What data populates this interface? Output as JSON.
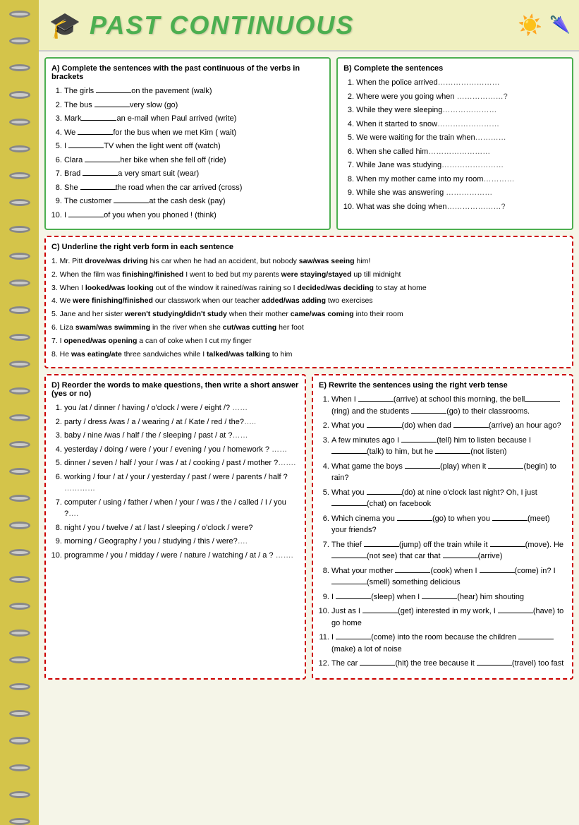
{
  "header": {
    "title": "PAST CONTINUOUS"
  },
  "sectionA": {
    "title": "A) Complete the sentences with the past continuous of the verbs in brackets",
    "items": [
      "The girls ______on the pavement  (walk)",
      "The bus __________very slow (go)",
      "Mark______an e-mail when Paul arrived (write)",
      "We ______for the bus when we met Kim ( wait)",
      "I ________TV when the light went off (watch)",
      "Clara ______her bike when she fell off (ride)",
      "Brad __________a very smart suit (wear)",
      "She ____the road when the car arrived (cross)",
      "The customer ______at the cash desk (pay)",
      "I ________of you when you phoned ! (think)"
    ]
  },
  "sectionB": {
    "title": "B) Complete the sentences",
    "items": [
      "When the police arrived……………………",
      "Where were you going when ………………?",
      "While they were sleeping…………………",
      "When it started to snow……………………",
      "We were waiting for the train when…………",
      "When she called him……………………",
      "While Jane was studying……………………",
      "When my mother came into my room…………",
      "While she was answering ………………",
      "What was she doing when…………………?"
    ]
  },
  "sectionC": {
    "title": "C) Underline the right verb form in each sentence",
    "items": [
      "Mr. Pitt drove/was driving his car when he had an accident, but nobody saw/was seeing him!",
      "When the film was finishing/finished I went to bed but my parents were staying/stayed up till midnight",
      "When I looked/was looking out of the window it rained/was raining so I decided/was deciding to stay at home",
      "We were finishing/finished our classwork when our teacher added/was adding two exercises",
      "Jane and her sister weren't studying/didn't study when their mother came/was coming into their room",
      "Liza swam/was swimming in the river when she cut/was cutting her foot",
      "I opened/was opening a can of coke when I cut my finger",
      "He was eating/ate three sandwiches while I talked/was talking to him"
    ],
    "bold_pairs": [
      [
        "drove/was driving",
        "saw/was seeing"
      ],
      [
        "was finishing/finished",
        "were staying/stayed"
      ],
      [
        "looked/was looking",
        "decided/was deciding"
      ],
      [
        "were finishing/finished",
        "added/was adding"
      ],
      [
        "weren't studying/didn't study",
        "came/was coming"
      ],
      [
        "swam/was swimming",
        "cut/was cutting"
      ],
      [
        "opened/was opening"
      ],
      [
        "was eating/ate",
        "talked/was talking"
      ]
    ]
  },
  "sectionD": {
    "title": "D) Reorder the words to make questions, then write a short answer (yes or no)",
    "items": [
      "you /at / dinner / having / o'clock / were / eight /? ……",
      "party / dress /was / a / wearing / at / Kate / red / the?…..",
      "baby / nine /was / half / the / sleeping / past / at ?……",
      "yesterday / doing / were / your / evening / you / homework ? ……",
      "dinner / seven / half / your / was / at / cooking / past / mother ?…….",
      "working / four / at / your / yesterday / past / were / parents / half ? …………",
      "computer / using / father / when / your / was / the / called / I / you ?….",
      "night / you / twelve / at / last / sleeping / o'clock / were?",
      "morning / Geography / you / studying / this / were?….",
      "programme / you / midday / were / nature / watching / at / a ? ……."
    ]
  },
  "sectionE": {
    "title": "E) Rewrite the sentences using the right verb tense",
    "items": [
      "When I ______(arrive) at school this morning, the bell_____(ring) and the students ______(go) to their classrooms.",
      "What you _____(do) when dad _____(arrive) an hour ago?",
      "A few minutes ago I _______(tell) him to listen because I _______(talk) to him, but he _______(not listen)",
      "What game the boys ______(play) when it ______(begin) to rain?",
      "What you _____(do) at nine o'clock last night? Oh, I just ______(chat) on facebook",
      "Which cinema you _______(go) to when you ______(meet) your friends?",
      "The thief ______(jump) off the train while it _______(move). He _______(not see) that car that ______(arrive)",
      "What your mother _______(cook) when I _____(come) in? I _______(smell) something delicious",
      "I _____(sleep) when I _______(hear) him shouting",
      "Just as I _______(get) interested in my work, I _______(have) to go home",
      "I ________(come) into the room because the children _______(make) a lot of noise",
      "The car _____(hit) the tree because it _____(travel) too fast"
    ]
  }
}
